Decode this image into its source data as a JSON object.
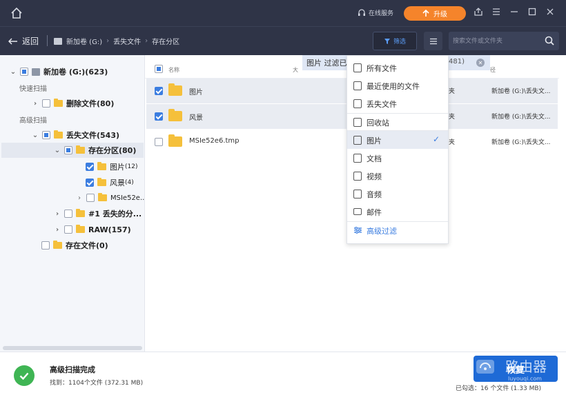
{
  "header": {
    "online_service": "在线服务",
    "upgrade_label": "升级"
  },
  "nav": {
    "back_label": "返回",
    "breadcrumb": [
      "新加卷 (G:)",
      "丢失文件",
      "存在分区"
    ],
    "filter_label": "筛选",
    "search_placeholder": "搜索文件或文件夹"
  },
  "sidebar": {
    "root": {
      "label": "新加卷 (G:)(623)"
    },
    "quick_scan": "快速扫描",
    "deleted": {
      "label": "删除文件(80)"
    },
    "advanced_scan": "高级扫描",
    "lost": {
      "label": "丢失文件(543)"
    },
    "partition": {
      "label": "存在分区(80)"
    },
    "pictures": {
      "label": "图片",
      "count": "(12)"
    },
    "scenery": {
      "label": "风景",
      "count": "(4)"
    },
    "msie": {
      "label": "MSIe52e..."
    },
    "lost_part": {
      "label": "#1 丢失的分..."
    },
    "raw": {
      "label": "RAW(157)"
    },
    "existing": {
      "label": "存在文件(0)"
    }
  },
  "table": {
    "col_name": "名称",
    "col_size_partial": "大",
    "col_path_partial": "径",
    "rows": [
      {
        "name": "图片",
        "type": "夹",
        "path": "新加卷 (G:)\\丢失文...",
        "checked": true
      },
      {
        "name": "风景",
        "type": "夹",
        "path": "新加卷 (G:)\\丢失文...",
        "checked": true
      },
      {
        "name": "MSIe52e6.tmp",
        "type": "夹",
        "path": "新加卷 (G:)\\丢失文...",
        "checked": false
      }
    ]
  },
  "filter_tip": {
    "label": "图片 过滤已",
    "count": "481)"
  },
  "dropdown": {
    "items": [
      {
        "label": "所有文件",
        "icon": "file-icon"
      },
      {
        "label": "最近使用的文件",
        "icon": "recent-file-icon"
      },
      {
        "label": "丢失文件",
        "icon": "lost-file-icon"
      },
      {
        "label": "回收站",
        "icon": "recycle-bin-icon"
      },
      {
        "label": "图片",
        "icon": "image-icon"
      },
      {
        "label": "文档",
        "icon": "document-icon"
      },
      {
        "label": "视频",
        "icon": "video-icon"
      },
      {
        "label": "音频",
        "icon": "audio-icon"
      },
      {
        "label": "邮件",
        "icon": "mail-icon"
      }
    ],
    "selected": "图片",
    "advanced": "高级过滤"
  },
  "footer": {
    "title": "高级扫描完成",
    "found": "找到：1104个文件 (372.31 MB)",
    "selected": "已勾选：16 个文件 (1.33 MB)",
    "recover_label": "恢复"
  },
  "watermark": {
    "brand": "路由器",
    "url": "luyouqi.com"
  },
  "colors": {
    "header_bg": "#2f3447",
    "accent": "#3b7de0",
    "upgrade": "#f5842b",
    "success": "#3fb554"
  }
}
